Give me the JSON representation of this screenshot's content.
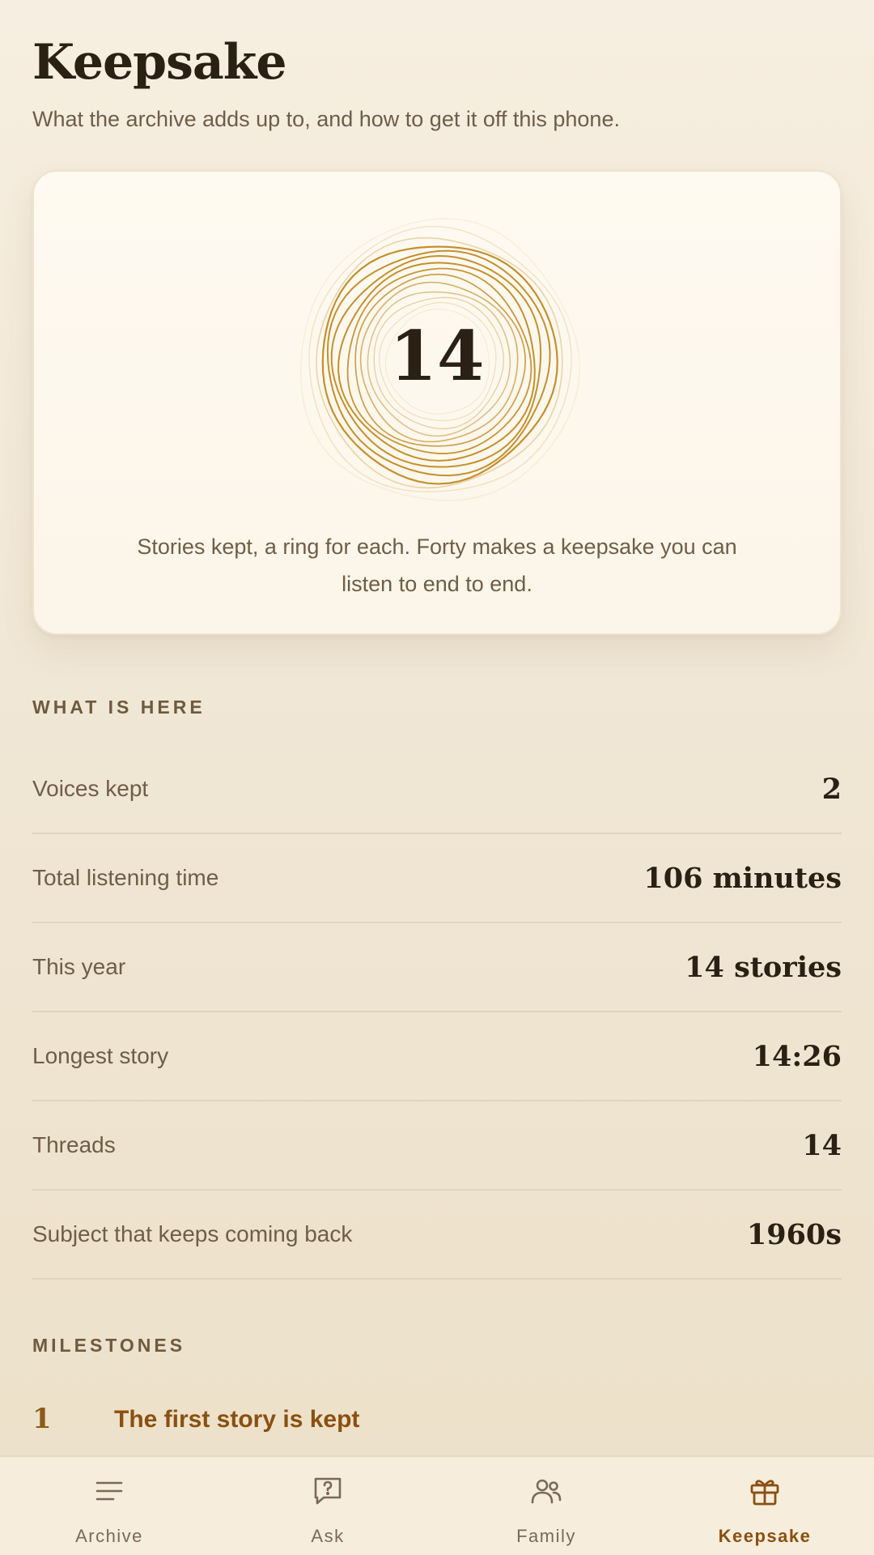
{
  "header": {
    "title": "Keepsake",
    "subtitle": "What the archive adds up to, and how to get it off this phone."
  },
  "hero": {
    "count": "14",
    "caption": "Stories kept, a ring for each. Forty makes a keepsake you can listen to end to end.",
    "ring_color": "#c4902e"
  },
  "stats": {
    "section_title": "WHAT IS HERE",
    "items": [
      {
        "label": "Voices kept",
        "value": "2"
      },
      {
        "label": "Total listening time",
        "value": "106 minutes"
      },
      {
        "label": "This year",
        "value": "14 stories"
      },
      {
        "label": "Longest story",
        "value": "14:26"
      },
      {
        "label": "Threads",
        "value": "14"
      },
      {
        "label": "Subject that keeps coming back",
        "value": "1960s"
      }
    ]
  },
  "milestones": {
    "section_title": "MILESTONES",
    "items": [
      {
        "number": "1",
        "title": "The first story is kept"
      }
    ]
  },
  "nav": {
    "active": "Keepsake",
    "accent": "#8a5010",
    "items": [
      {
        "label": "Archive",
        "icon": "menu-lines-icon"
      },
      {
        "label": "Ask",
        "icon": "question-bubble-icon"
      },
      {
        "label": "Family",
        "icon": "people-icon"
      },
      {
        "label": "Keepsake",
        "icon": "gift-icon"
      }
    ]
  }
}
